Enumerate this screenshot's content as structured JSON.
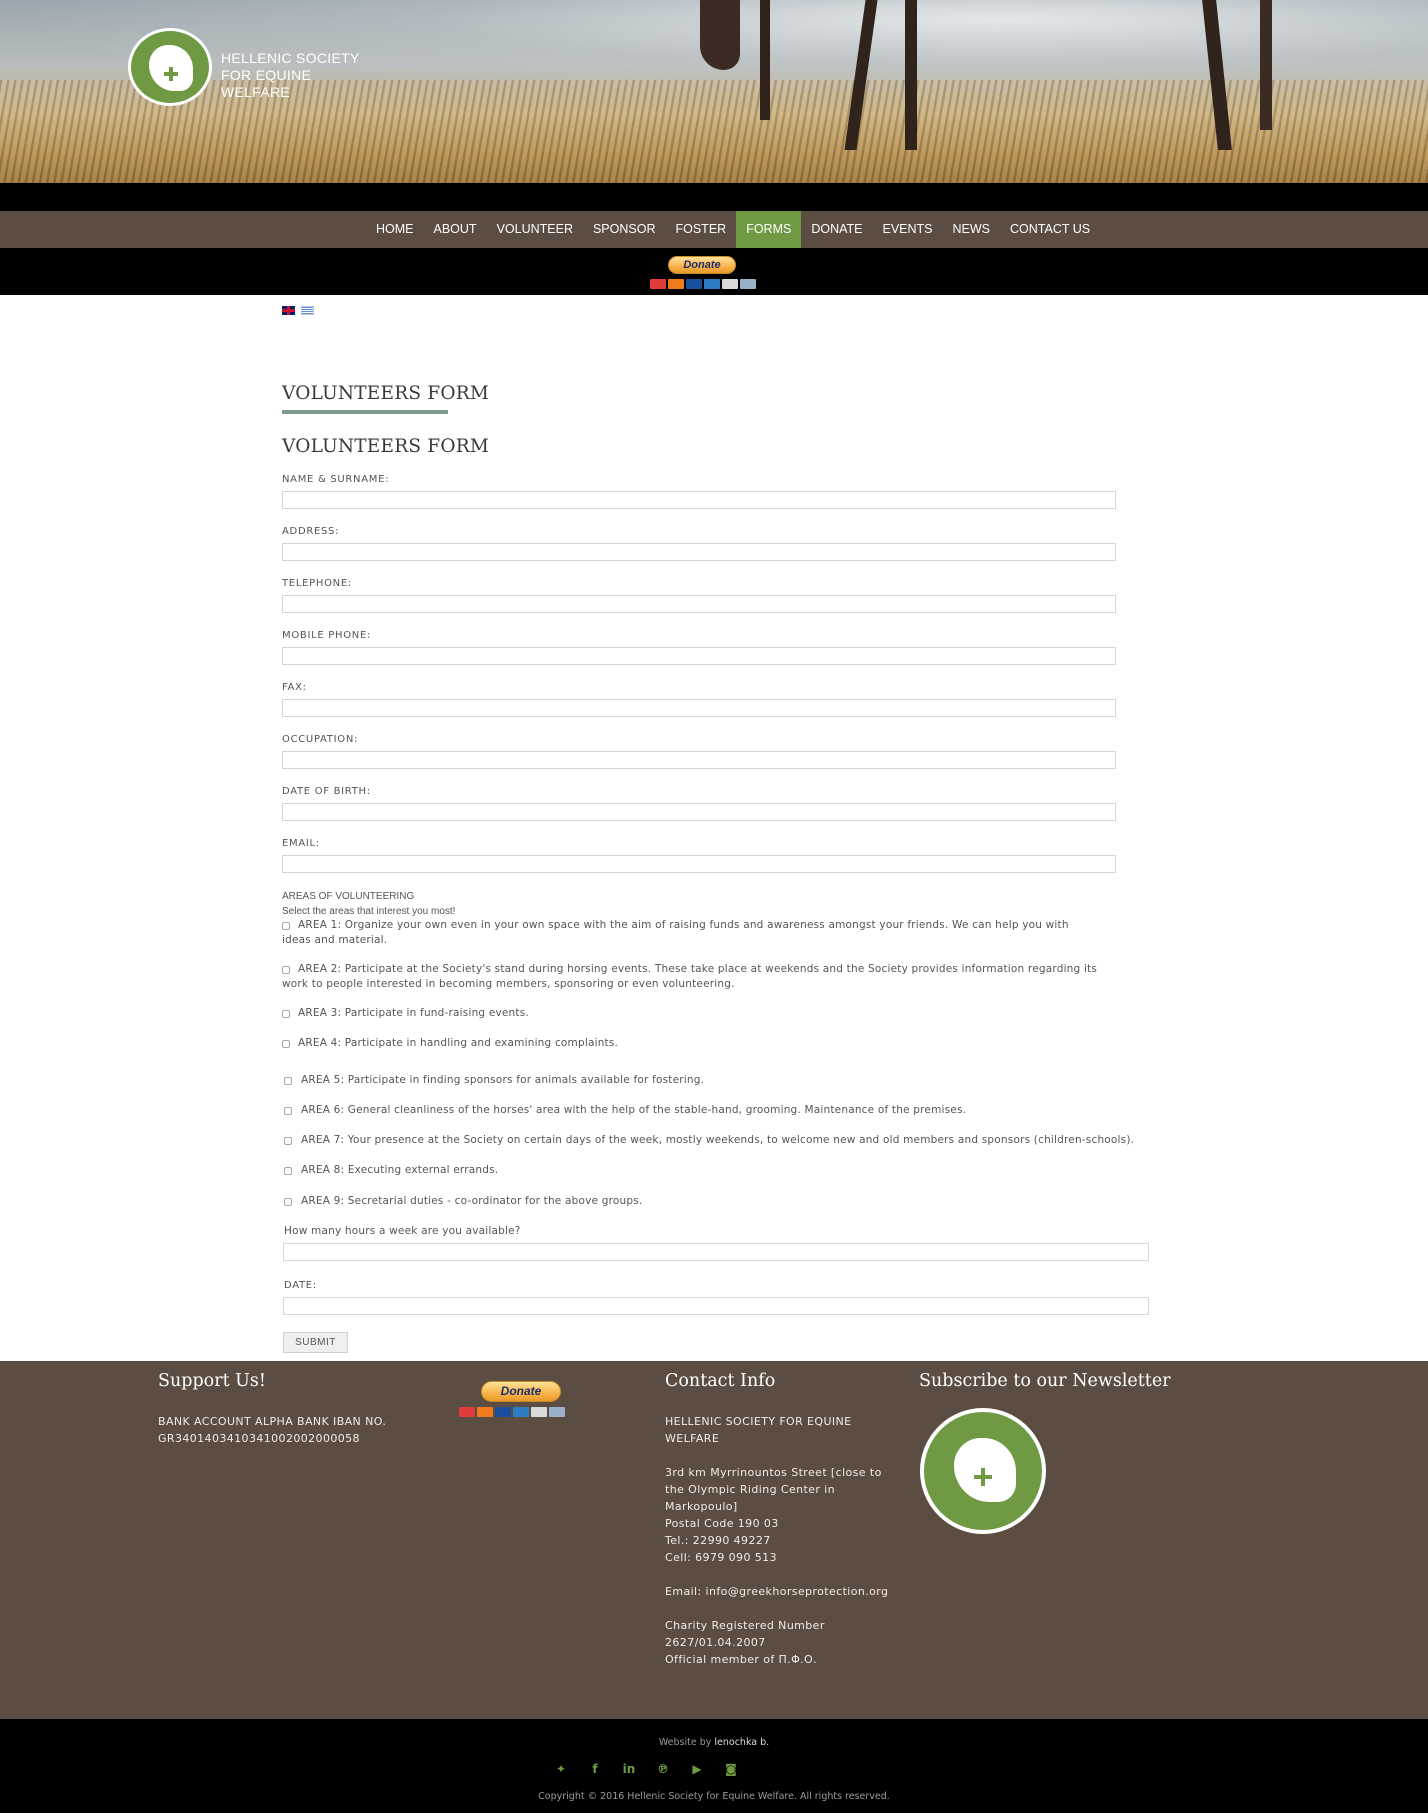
{
  "header": {
    "site_name": [
      "HELLENIC SOCIETY",
      "FOR EQUINE",
      "WELFARE"
    ]
  },
  "nav": {
    "items": [
      "HOME",
      "ABOUT",
      "VOLUNTEER",
      "SPONSOR",
      "FOSTER",
      "FORMS",
      "DONATE",
      "EVENTS",
      "NEWS",
      "CONTACT US"
    ],
    "active": "FORMS"
  },
  "donate_button": {
    "label": "Donate"
  },
  "languages": [
    {
      "icon": "uk-flag-icon"
    },
    {
      "icon": "greek-flag-icon"
    }
  ],
  "page": {
    "title": "VOLUNTEERS FORM",
    "form_title": "VOLUNTEERS FORM"
  },
  "form": {
    "fields": [
      {
        "label": "NAME & SURNAME:",
        "value": ""
      },
      {
        "label": "ADDRESS:",
        "value": ""
      },
      {
        "label": "TELEPHONE:",
        "value": ""
      },
      {
        "label": "MOBILE PHONE:",
        "value": ""
      },
      {
        "label": "FAX:",
        "value": ""
      },
      {
        "label": "OCCUPATION:",
        "value": ""
      },
      {
        "label": "DATE OF BIRTH:",
        "value": ""
      },
      {
        "label": "EMAIL:",
        "value": ""
      }
    ],
    "areas_heading": "AREAS OF VOLUNTEERING",
    "areas_sub": "Select the areas that interest you most!",
    "areas": [
      {
        "text": "AREA 1: Organize your own even in your own space with the aim of raising funds and awareness amongst your friends. We can help you with ideas and material.",
        "checked": false
      },
      {
        "text": "AREA 2: Participate at the Society's stand during horsing events. These take place at weekends and the Society provides information regarding its work to people interested in becoming members, sponsoring or even volunteering.",
        "checked": false
      },
      {
        "text": "AREA 3: Participate in fund-raising events.",
        "checked": false
      },
      {
        "text": "AREA 4: Participate in handling and examining complaints.",
        "checked": false
      },
      {
        "text": "AREA 5: Participate in finding sponsors for animals available for fostering.",
        "checked": false
      },
      {
        "text": "AREA 6: General cleanliness of the horses' area with the help of the stable-hand, grooming. Maintenance of the premises.",
        "checked": false
      },
      {
        "text": "AREA 7: Your presence at the Society on certain days of the week, mostly weekends, to welcome new and old members and sponsors (children-schools).",
        "checked": false
      },
      {
        "text": "AREA 8: Executing external errands.",
        "checked": false
      },
      {
        "text": "AREA 9: Secretarial duties - co-ordinator for the above groups.",
        "checked": false
      }
    ],
    "hours_label": "How many hours a week are you available?",
    "hours_value": "",
    "date_label": "DATE:",
    "date_value": "",
    "submit_label": "SUBMIT"
  },
  "footer": {
    "support": {
      "heading": "Support Us!",
      "lines": [
        "BANK ACCOUNT ALPHA BANK IBAN NO.",
        "GR3401403410341002002000058"
      ]
    },
    "contact": {
      "heading": "Contact Info",
      "lines": [
        "HELLENIC SOCIETY FOR EQUINE",
        "WELFARE",
        "",
        "3rd km Myrrinountos Street [close to",
        "the Olympic Riding Center in",
        "Markopoulo]",
        "Postal Code 190 03",
        "Tel.: 22990 49227",
        "Cell: 6979 090 513",
        "",
        "Email: info@greekhorseprotection.org",
        "",
        "Charity Registered Number",
        "2627/01.04.2007",
        "Official member of Π.Φ.Ο."
      ]
    },
    "newsletter": {
      "heading": "Subscribe to our Newsletter"
    }
  },
  "bottom": {
    "credit_prefix": "Website by",
    "credit_name": "lenochka b.",
    "social": [
      "twitter-icon",
      "facebook-icon",
      "linkedin-icon",
      "pinterest-icon",
      "youtube-icon",
      "instagram-icon"
    ],
    "copyright": "Copyright © 2016 Hellenic Society for Equine Welfare. All rights reserved."
  },
  "colors": {
    "brand_green": "#6f9a43",
    "nav_brown": "#5b4d41",
    "footer_brown": "#5b4d41",
    "underline": "#7f9a8b"
  }
}
